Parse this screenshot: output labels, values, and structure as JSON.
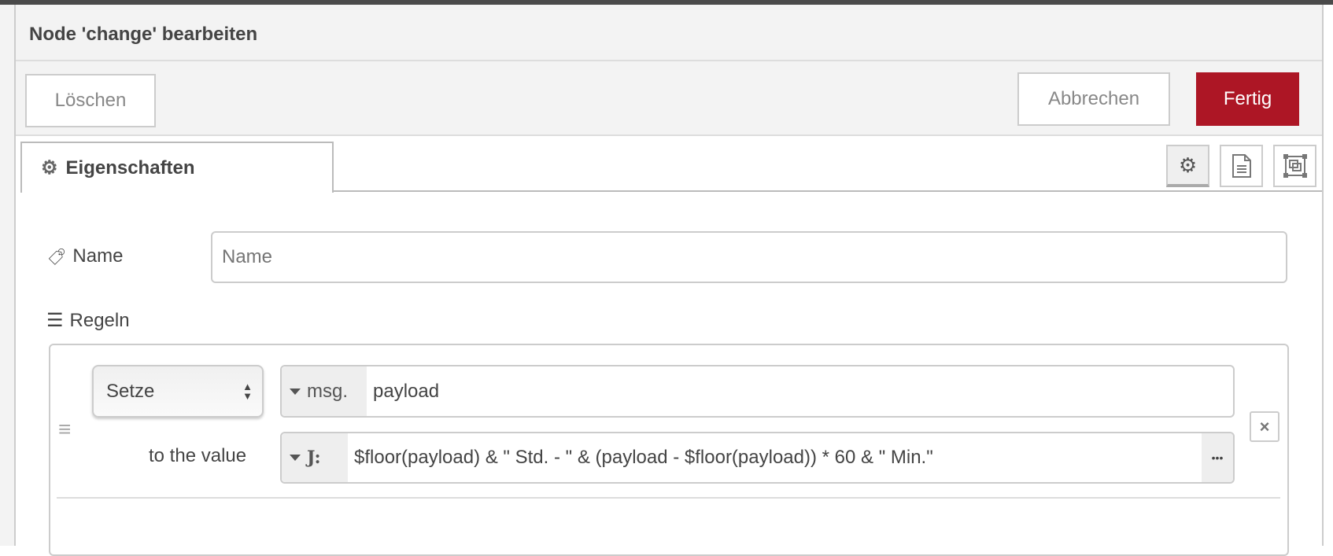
{
  "dialog": {
    "title": "Node 'change' bearbeiten"
  },
  "buttons": {
    "delete": "Löschen",
    "cancel": "Abbrechen",
    "done": "Fertig"
  },
  "colors": {
    "primary": "#ad1625"
  },
  "tabs": [
    {
      "label": "Eigenschaften",
      "icon": "gear-icon"
    }
  ],
  "side_icons": [
    "gear-icon",
    "document-icon",
    "frame-icon"
  ],
  "form": {
    "name_label": "Name",
    "name_placeholder": "Name",
    "name_value": "",
    "rules_label": "Regeln"
  },
  "rules": [
    {
      "action": "Setze",
      "target_type": "msg.",
      "target": "payload",
      "value_label": "to the value",
      "value_type": "J:",
      "value": "$floor(payload) & \" Std. - \" & (payload - $floor(payload)) * 60 & \" Min.\"",
      "more": "•••",
      "delete": "×"
    }
  ]
}
